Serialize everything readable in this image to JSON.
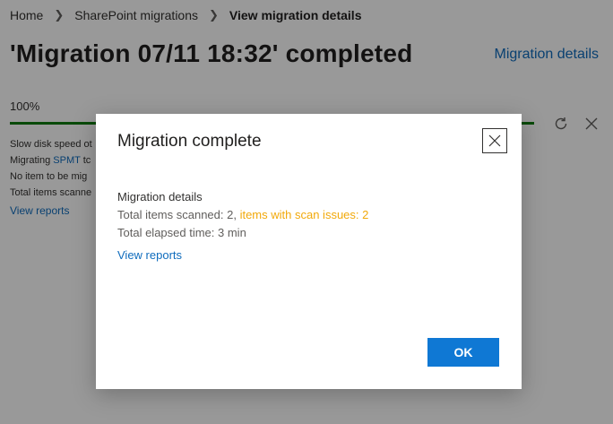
{
  "breadcrumb": {
    "home": "Home",
    "migrations": "SharePoint migrations",
    "current": "View migration details"
  },
  "page": {
    "title": "'Migration 07/11 18:32' completed",
    "details_link": "Migration details"
  },
  "progress": {
    "percent_label": "100%",
    "value": 1.0
  },
  "info": {
    "line1": "Slow disk speed ot",
    "line2_prefix": "Migrating ",
    "line2_link": "SPMT",
    "line2_suffix": " tc",
    "line3": "No item to be mig",
    "line4": "Total items scanne",
    "view_reports": "View reports"
  },
  "dialog": {
    "title": "Migration complete",
    "heading": "Migration details",
    "scanned_prefix": "Total items scanned: 2, ",
    "scan_issues": "items with scan issues: 2",
    "elapsed": "Total elapsed time: 3 min",
    "view_reports": "View reports",
    "ok_label": "OK"
  },
  "colors": {
    "accent": "#0f78d4",
    "link": "#0f6cbd",
    "progress": "#107c10",
    "warning": "#f2a90a"
  },
  "icons": {
    "breadcrumb_separator": "chevron-right-icon",
    "refresh": "refresh-icon",
    "close": "close-icon"
  }
}
